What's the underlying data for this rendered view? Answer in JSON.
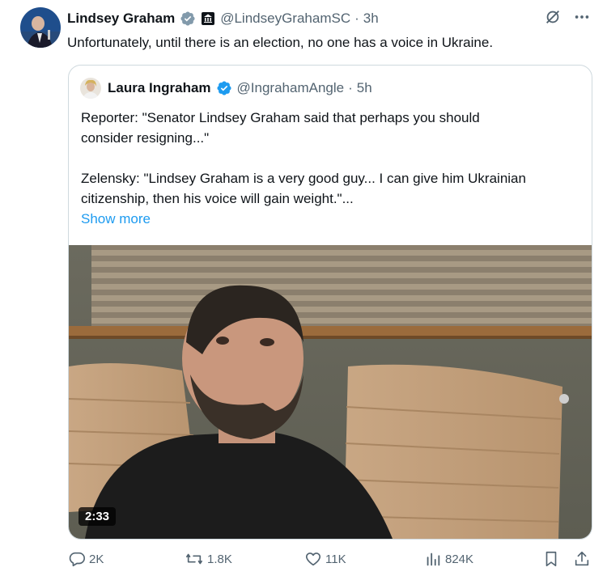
{
  "tweet": {
    "author_name": "Lindsey Graham",
    "author_handle": "@LindseyGrahamSC",
    "time": "3h",
    "text": "Unfortunately, until there is an election, no one has a voice in Ukraine."
  },
  "quote": {
    "author_name": "Laura Ingraham",
    "author_handle": "@IngrahamAngle",
    "time": "5h",
    "line1": "Reporter: \"Senator Lindsey Graham said that perhaps you should",
    "line2": "consider resigning...\"",
    "line3": "Zelensky: \"Lindsey Graham is a very good guy... I can give him Ukrainian",
    "line4": "citizenship, then his voice will gain weight.\"...",
    "show_more": "Show more",
    "video_duration": "2:33"
  },
  "actions": {
    "replies": "2K",
    "reposts": "1.8K",
    "likes": "11K",
    "views": "824K"
  },
  "colors": {
    "verified": "#1d9bf0",
    "gov_badge": "#829aab",
    "muted": "#536471",
    "link": "#1d9bf0"
  },
  "separator": "·"
}
